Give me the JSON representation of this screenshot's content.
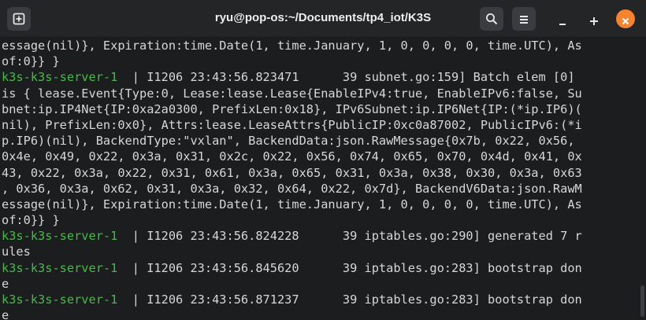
{
  "window": {
    "title": "ryu@pop-os:~/Documents/tp4_iot/K3S",
    "icons": {
      "new_tab": "new-tab-icon",
      "search": "search-icon",
      "menu": "hamburger-menu-icon",
      "minimize": "minimize-icon",
      "maximize": "maximize-icon",
      "close": "close-icon"
    },
    "colors": {
      "close_accent": "#f5832f",
      "host_green": "#48b948",
      "text": "#d7d7d7",
      "background": "#1c1d1f"
    }
  },
  "terminal": {
    "lines": [
      {
        "host": "",
        "text": "essage(nil)}, Expiration:time.Date(1, time.January, 1, 0, 0, 0, 0, time.UTC), As"
      },
      {
        "host": "",
        "text": "of:0}} }"
      },
      {
        "host": "k3s-k3s-server-1",
        "text": "  | I1206 23:43:56.823471      39 subnet.go:159] Batch elem [0]"
      },
      {
        "host": "",
        "text": "is { lease.Event{Type:0, Lease:lease.Lease{EnableIPv4:true, EnableIPv6:false, Su"
      },
      {
        "host": "",
        "text": "bnet:ip.IP4Net{IP:0xa2a0300, PrefixLen:0x18}, IPv6Subnet:ip.IP6Net{IP:(*ip.IP6)("
      },
      {
        "host": "",
        "text": "nil), PrefixLen:0x0}, Attrs:lease.LeaseAttrs{PublicIP:0xc0a87002, PublicIPv6:(*i"
      },
      {
        "host": "",
        "text": "p.IP6)(nil), BackendType:\"vxlan\", BackendData:json.RawMessage{0x7b, 0x22, 0x56,"
      },
      {
        "host": "",
        "text": "0x4e, 0x49, 0x22, 0x3a, 0x31, 0x2c, 0x22, 0x56, 0x74, 0x65, 0x70, 0x4d, 0x41, 0x"
      },
      {
        "host": "",
        "text": "43, 0x22, 0x3a, 0x22, 0x31, 0x61, 0x3a, 0x65, 0x31, 0x3a, 0x38, 0x30, 0x3a, 0x63"
      },
      {
        "host": "",
        "text": ", 0x36, 0x3a, 0x62, 0x31, 0x3a, 0x32, 0x64, 0x22, 0x7d}, BackendV6Data:json.RawM"
      },
      {
        "host": "",
        "text": "essage(nil)}, Expiration:time.Date(1, time.January, 1, 0, 0, 0, 0, time.UTC), As"
      },
      {
        "host": "",
        "text": "of:0}} }"
      },
      {
        "host": "k3s-k3s-server-1",
        "text": "  | I1206 23:43:56.824228      39 iptables.go:290] generated 7 r"
      },
      {
        "host": "",
        "text": "ules"
      },
      {
        "host": "k3s-k3s-server-1",
        "text": "  | I1206 23:43:56.845620      39 iptables.go:283] bootstrap don"
      },
      {
        "host": "",
        "text": "e"
      },
      {
        "host": "k3s-k3s-server-1",
        "text": "  | I1206 23:43:56.871237      39 iptables.go:283] bootstrap don"
      },
      {
        "host": "",
        "text": "e"
      }
    ]
  }
}
